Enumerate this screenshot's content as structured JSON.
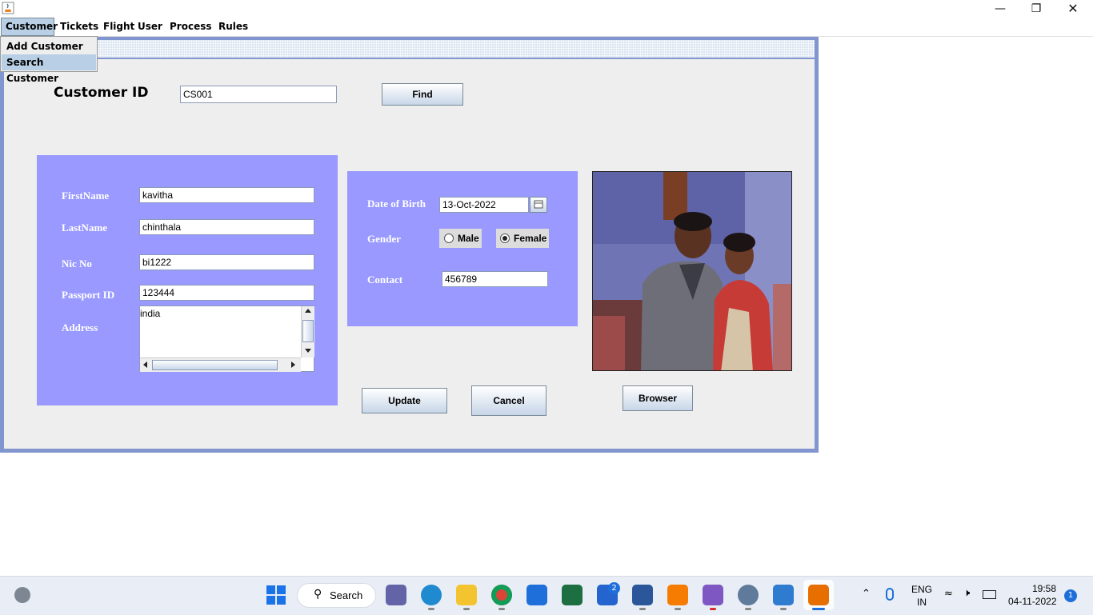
{
  "menubar": {
    "items": [
      "Customer",
      "Tickets",
      "Flight",
      "User",
      "Process",
      "Rules"
    ],
    "active": "Customer"
  },
  "dropdown": {
    "items": [
      "Add Customer",
      "Search Customer"
    ],
    "selected": "Search Customer"
  },
  "search": {
    "label": "Customer ID",
    "value": "CS001",
    "find_label": "Find"
  },
  "personal": {
    "firstname_label": "FirstName",
    "firstname": "kavitha",
    "lastname_label": "LastName",
    "lastname": "chinthala",
    "nic_label": "Nic No",
    "nic": "bi1222",
    "passport_label": "Passport ID",
    "passport": "123444",
    "address_label": "Address",
    "address": "india"
  },
  "details": {
    "dob_label": "Date of Birth",
    "dob": "13-Oct-2022",
    "gender_label": "Gender",
    "male_label": "Male",
    "female_label": "Female",
    "gender_selected": "Female",
    "contact_label": "Contact",
    "contact": "456789"
  },
  "buttons": {
    "update": "Update",
    "cancel": "Cancel",
    "browser": "Browser"
  },
  "taskbar": {
    "search_label": "Search",
    "lang_top": "ENG",
    "lang_bottom": "IN",
    "time": "19:58",
    "date": "04-11-2022",
    "todo_badge": "2",
    "notification_count": "1"
  },
  "colors": {
    "panel": "#9999ff",
    "frame_border": "#8195cf",
    "menu_active": "#b8cfe5"
  }
}
